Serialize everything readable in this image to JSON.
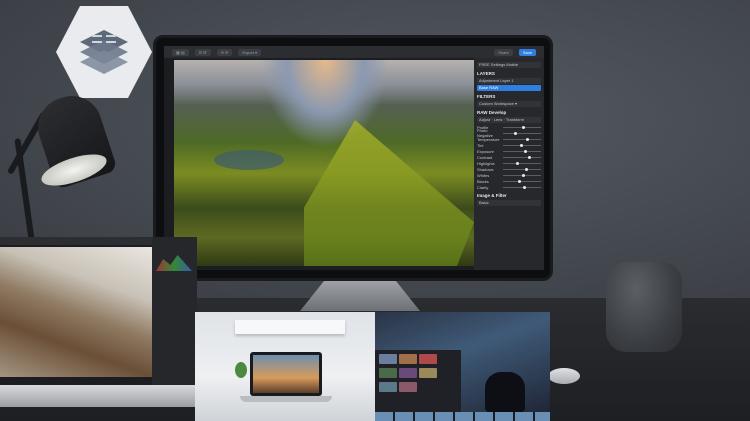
{
  "monitor": {
    "toolbar": {
      "left_buttons": [
        "▦ ▤",
        "⊡ ⊟",
        "⟲ ⟳"
      ],
      "center_label": "Export ▾",
      "right_buttons": [
        "Share",
        "Save"
      ]
    },
    "panel": {
      "top_labels": [
        "FREE",
        "Settings",
        "Mobile"
      ],
      "layers_header": "LAYERS",
      "layer_items": [
        "Adjustment Layer 1",
        "Base RAW"
      ],
      "filters_header": "FILTERS",
      "filters_button": "Custom Workspace ▾",
      "section_header": "RAW Develop",
      "tabs": [
        "Adjust",
        "Lens",
        "Transform"
      ],
      "sliders": [
        "Profile",
        "Photo Negative",
        "Temperature",
        "Tint",
        "Exposure",
        "Contrast",
        "Highlights",
        "Shadows",
        "Whites",
        "Blacks",
        "Clarity"
      ],
      "footer_header": "Image & Filter",
      "footer_row": "Basic"
    }
  },
  "colors": {
    "accent": "#2f7fe0",
    "panel_bg": "#26282c",
    "wall": "#43474e"
  },
  "icons": [
    "layers-logo-icon",
    "desk-lamp",
    "smart-speaker",
    "mouse"
  ]
}
